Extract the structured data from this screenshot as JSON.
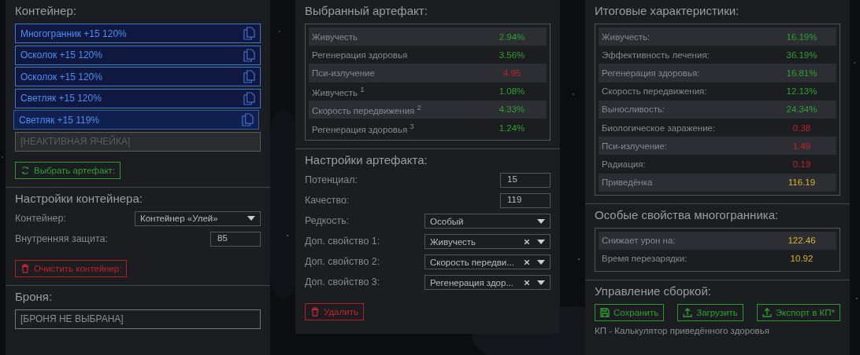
{
  "container": {
    "title": "Контейнер:",
    "slots": [
      {
        "kind": "artifact",
        "label": "Многогранник +15 120%",
        "selected": false
      },
      {
        "kind": "artifact",
        "label": "Осколок +15 120%",
        "selected": false
      },
      {
        "kind": "artifact",
        "label": "Осколок +15 120%",
        "selected": false
      },
      {
        "kind": "artifact",
        "label": "Светляк +15 120%",
        "selected": false
      },
      {
        "kind": "artifact",
        "label": "Светляк +15 119%",
        "selected": true
      },
      {
        "kind": "inactive",
        "label": "[НЕАКТИВНАЯ ЯЧЕЙКА]",
        "selected": false
      }
    ],
    "pick_button": "Выбрать артефакт:"
  },
  "container_settings": {
    "title": "Настройки контейнера:",
    "fields": [
      {
        "kind": "select",
        "label": "Контейнер:",
        "value": "Контейнер «Улей»"
      },
      {
        "kind": "number",
        "label": "Внутренняя защита:",
        "value": "85"
      }
    ],
    "clear_button": "Очистить контейнер:"
  },
  "armor": {
    "title": "Броня:",
    "value": "[БРОНЯ НЕ ВЫБРАНА]"
  },
  "selected_artifact": {
    "title": "Выбранный артефакт:",
    "stats": [
      {
        "name": "Живучесть",
        "value": "2.94%",
        "kind": "positive"
      },
      {
        "name": "Регенерация здоровья",
        "value": "3.56%",
        "kind": "positive"
      },
      {
        "name": "Пси-излучение",
        "value": "4.95",
        "kind": "negative"
      },
      {
        "name": "Живучесть $^{1}$",
        "value": "1.08%",
        "kind": "positive"
      },
      {
        "name": "Скорость передвижения $^{2}$",
        "value": "4.33%",
        "kind": "positive"
      },
      {
        "name": "Регенерация здоровья $^{3}$",
        "value": "1.24%",
        "kind": "positive"
      }
    ]
  },
  "artifact_settings": {
    "title": "Настройки артефакта:",
    "fields": [
      {
        "kind": "number",
        "label": "Потенциал:",
        "value": "15"
      },
      {
        "kind": "number",
        "label": "Качество:",
        "value": "119"
      },
      {
        "kind": "select",
        "label": "Редкость:",
        "value": "Особый"
      },
      {
        "kind": "clearable",
        "label": "Доп. свойство 1:",
        "value": "Живучесть"
      },
      {
        "kind": "clearable",
        "label": "Доп. свойство 2:",
        "value": "Скорость передви..."
      },
      {
        "kind": "clearable",
        "label": "Доп. свойство 3:",
        "value": "Регенерация здор..."
      }
    ],
    "delete_button": "Удалить"
  },
  "totals": {
    "title": "Итоговые характеристики:",
    "stats": [
      {
        "name": "Живучесть:",
        "value": "16.19%",
        "kind": "positive"
      },
      {
        "name": "Эффективность лечения:",
        "value": "36.19%",
        "kind": "positive"
      },
      {
        "name": "Регенерация здоровья:",
        "value": "16.81%",
        "kind": "positive"
      },
      {
        "name": "Скорость передвижения:",
        "value": "12.13%",
        "kind": "positive"
      },
      {
        "name": "Выносливость:",
        "value": "24.34%",
        "kind": "positive"
      },
      {
        "name": "Биологическое заражение:",
        "value": "0.38",
        "kind": "negative"
      },
      {
        "name": "Пси-излучение:",
        "value": "1.49",
        "kind": "negative"
      },
      {
        "name": "Радиация:",
        "value": "0.19",
        "kind": "negative"
      },
      {
        "name": "Приведёнка",
        "value": "116.19",
        "kind": "neutral"
      }
    ]
  },
  "polyhedron": {
    "title": "Особые свойства многогранника:",
    "stats": [
      {
        "name": "Снижает урон на:",
        "value": "122.46",
        "kind": "neutral"
      },
      {
        "name": "Время перезарядки:",
        "value": "10.92",
        "kind": "neutral"
      }
    ]
  },
  "build": {
    "title": "Управление сборкой:",
    "buttons": [
      {
        "kind": "save",
        "label": "Сохранить"
      },
      {
        "kind": "upload",
        "label": "Загрузить"
      },
      {
        "kind": "upload",
        "label": "Экспорт в КП*"
      }
    ],
    "note": "КП - Калькулятор приведённого здоровья"
  }
}
